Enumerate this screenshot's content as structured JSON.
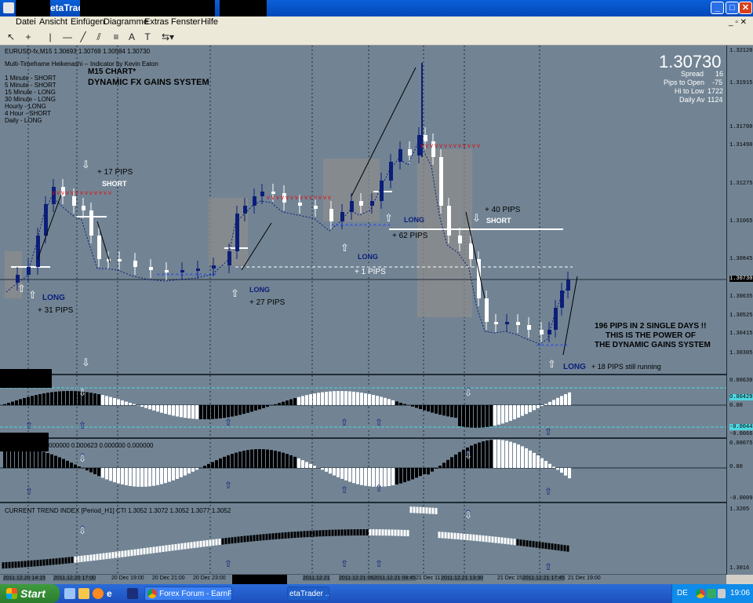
{
  "window": {
    "title": "etaTrad"
  },
  "menu": [
    "Datei",
    "Ansicht",
    "Einfügen",
    "Diagramme",
    "Extras",
    "Fenster",
    "Hilfe"
  ],
  "chart": {
    "symbol_line": "EURUSD-fx,M15  1.30693 1.30769 1.30584 1.30730",
    "indicator_line": "Multi-Timeframe Heikenashi -- Indicator by Kevin Eaton",
    "timeframes": [
      "1 Minute - SHORT",
      "5 Minute - SHORT",
      "15 Minute - LONG",
      "30 Minute - LONG",
      "Hourly - LONG",
      "4 Hour - SHORT",
      "Daily - LONG"
    ],
    "heading1": "M15 CHART*",
    "heading2": "DYNAMIC FX GAINS SYSTEM",
    "big_price": "1.30730",
    "stats": [
      {
        "label": "Spread",
        "value": "16"
      },
      {
        "label": "Pips to Open",
        "value": "-75"
      },
      {
        "label": "Hi to Low",
        "value": "1722"
      },
      {
        "label": "Daily Av",
        "value": "1124"
      }
    ],
    "annotations": {
      "long1": "LONG",
      "pips1": "+ 31 PIPS",
      "pips2": "+ 17 PIPS",
      "short1": "SHORT",
      "long2": "LONG",
      "pips3": "+ 27 PIPS",
      "long3": "LONG",
      "pips4": "+ 1 PIPS",
      "long4": "LONG",
      "pips5": "+ 62 PIPS",
      "pips6": "+ 40 PIPS",
      "short2": "SHORT",
      "claim1": "196 PIPS IN 2 SINGLE DAYS !!",
      "claim2": "THIS IS THE POWER OF",
      "claim3": "THE DYNAMIC GAINS SYSTEM",
      "long5": "LONG",
      "running": "+ 18 PIPS still running"
    },
    "price_scale": [
      "1.32120",
      "1.31915",
      "1.31700",
      "1.31490",
      "1.31275",
      "1.31065",
      "1.30845",
      "1.30730",
      "1.30635",
      "1.30525",
      "1.30415",
      "1.30305"
    ],
    "current_price_tag": "1.30730",
    "sub1_scale": [
      "0.00630",
      "0.00429",
      "0.00",
      "-0.00447",
      "-0.00663"
    ],
    "sub2_header": "000000 0.000623 0.000000 0.000000",
    "sub2_scale": [
      "0.000757",
      "0.00",
      "-0.00096"
    ],
    "sub3_header": "CURRENT TREND INDEX [Period_H1] CTI 1.3052 1.3072 1.3052 1.3077 1.3052",
    "sub3_scale": [
      "1.3205",
      "1.3016"
    ],
    "time_axis": [
      "2011.12.20 14:15",
      "2011.12.20 17:00",
      "20 Dec 19:00",
      "20 Dec 21:00",
      "20 Dec 23:00",
      "21 Dec 01:00",
      "2011.12.21",
      "21 Dec 05:00",
      "2011.12.21 06:45",
      "2011.12.21 08:45",
      "21 Dec 09:00",
      "21 Dec 11:00",
      "2011.12.21 13:30",
      "21 Dec 15:00",
      "2011.12.21 17:45",
      "21 Dec 19:00"
    ]
  },
  "taskbar": {
    "start": "Start",
    "task1": "Forex Forum - EarnF...",
    "task2": "etaTrader ...",
    "lang": "DE",
    "clock": "19:06"
  },
  "colors": {
    "chart_bg": "#728494",
    "bull": "#0b1e78",
    "bear": "#ffffff",
    "grid": "#1e2a35"
  }
}
